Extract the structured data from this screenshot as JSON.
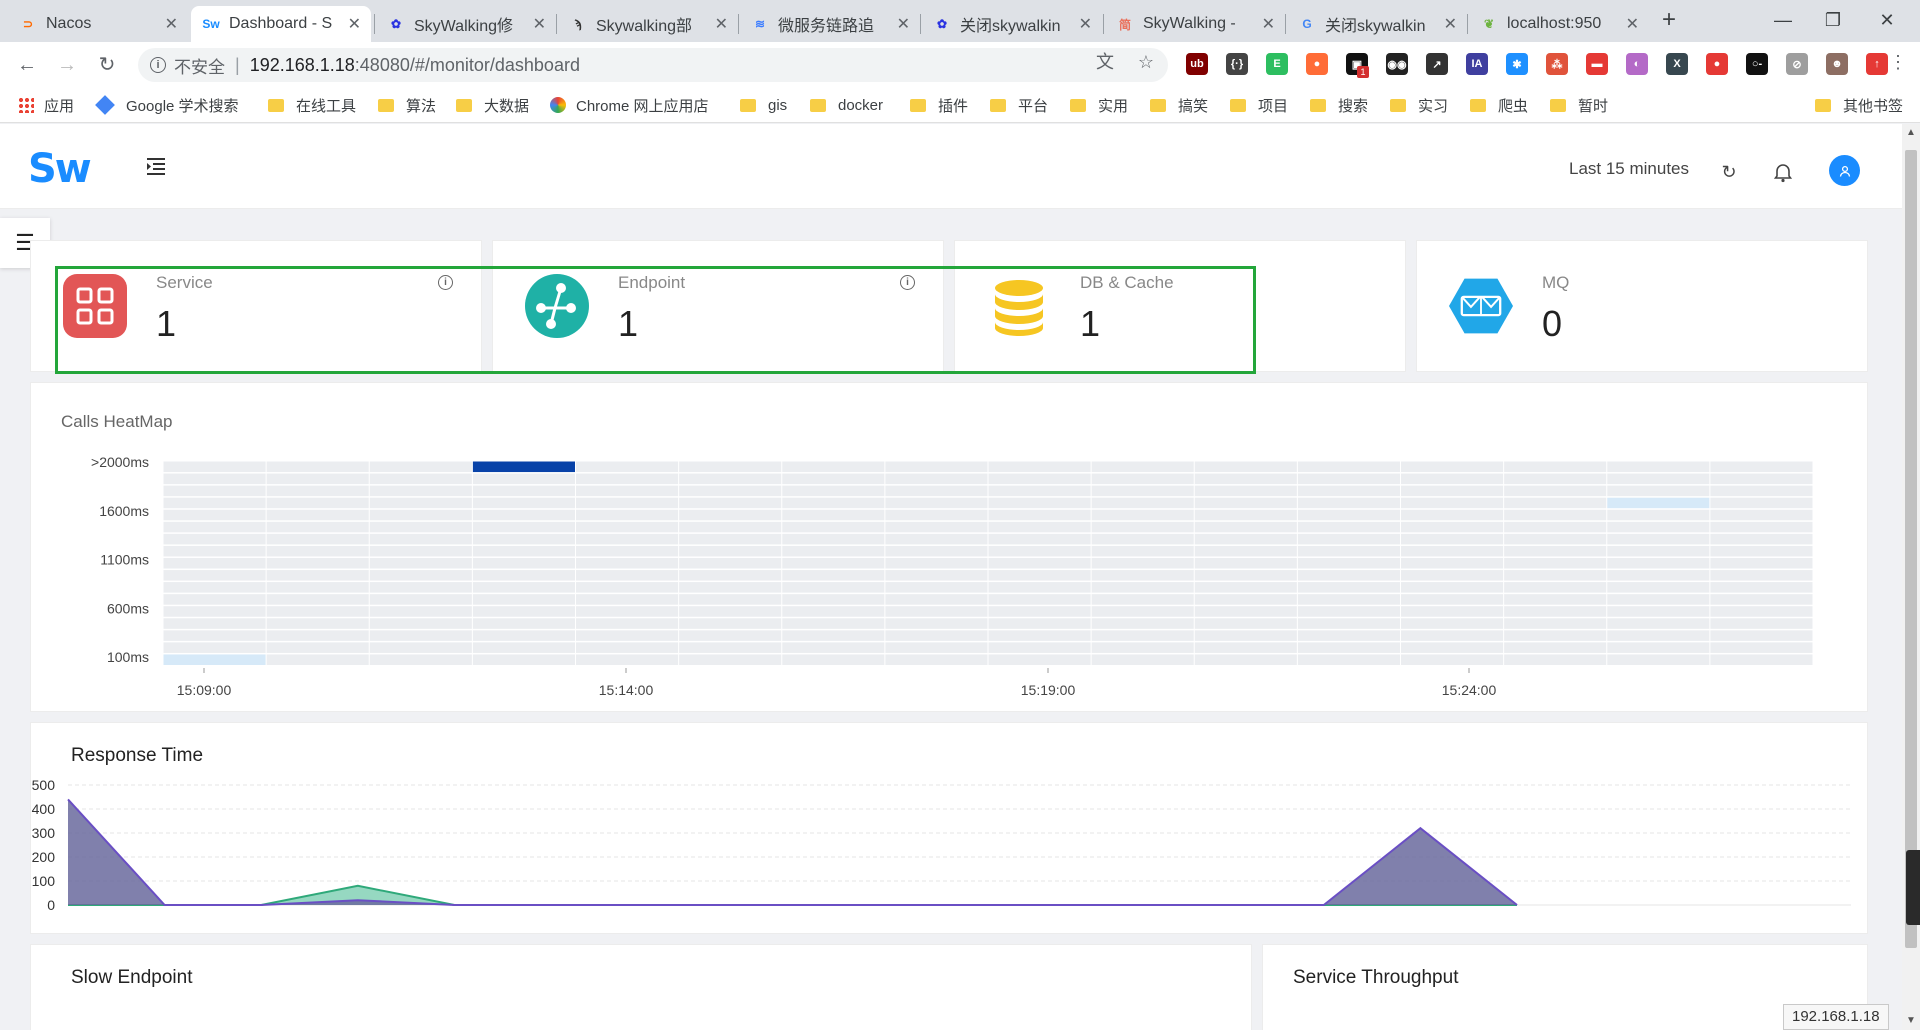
{
  "browser": {
    "tabs": [
      {
        "title": "Nacos",
        "icon": "nacos-icon",
        "color": "#ff6a00",
        "glyph": "⊃"
      },
      {
        "title": "Dashboard - S",
        "icon": "skywalking-icon",
        "color": "#1a8cff",
        "glyph": "Sw"
      },
      {
        "title": "SkyWalking修",
        "icon": "baidu-paw-icon",
        "color": "#2932e1",
        "glyph": "✿"
      },
      {
        "title": "Skywalking部",
        "icon": "yuque-icon",
        "color": "#333333",
        "glyph": "ϡ"
      },
      {
        "title": "微服务链路追",
        "icon": "tencent-cloud-icon",
        "color": "#3b7cff",
        "glyph": "≋"
      },
      {
        "title": "关闭skywalkin",
        "icon": "baidu-paw-icon",
        "color": "#2932e1",
        "glyph": "✿"
      },
      {
        "title": "SkyWalking -",
        "icon": "jianshu-icon",
        "color": "#ea6f5a",
        "glyph": "简"
      },
      {
        "title": "关闭skywalkin",
        "icon": "google-icon",
        "color": "#4285f4",
        "glyph": "G"
      },
      {
        "title": "localhost:950",
        "icon": "spring-leaf-icon",
        "color": "#6db33f",
        "glyph": "❦"
      }
    ],
    "url": {
      "insecure_label": "不安全",
      "host": "192.168.1.18",
      "path": ":48080/#/monitor/dashboard"
    },
    "bookmarks": [
      {
        "label": "应用",
        "kind": "apps"
      },
      {
        "label": "Google 学术搜索",
        "kind": "gem"
      },
      {
        "label": "在线工具",
        "kind": "folder"
      },
      {
        "label": "算法",
        "kind": "folder"
      },
      {
        "label": "大数据",
        "kind": "folder"
      },
      {
        "label": "Chrome 网上应用店",
        "kind": "rainbow"
      },
      {
        "label": "gis",
        "kind": "folder"
      },
      {
        "label": "docker",
        "kind": "folder"
      },
      {
        "label": "插件",
        "kind": "folder"
      },
      {
        "label": "平台",
        "kind": "folder"
      },
      {
        "label": "实用",
        "kind": "folder"
      },
      {
        "label": "搞笑",
        "kind": "folder"
      },
      {
        "label": "项目",
        "kind": "folder"
      },
      {
        "label": "搜索",
        "kind": "folder"
      },
      {
        "label": "实习",
        "kind": "folder"
      },
      {
        "label": "爬虫",
        "kind": "folder"
      },
      {
        "label": "暂时",
        "kind": "folder"
      }
    ],
    "other_bookmarks": "其他书签",
    "extensions": [
      {
        "name": "ublock-icon",
        "color": "#800000",
        "glyph": "ub"
      },
      {
        "name": "json-viewer-icon",
        "color": "#444444",
        "glyph": "{·}"
      },
      {
        "name": "evernote-icon",
        "color": "#2dbe60",
        "glyph": "E"
      },
      {
        "name": "postman-icon",
        "color": "#ff6c37",
        "glyph": "●"
      },
      {
        "name": "extension-badge-icon",
        "color": "#111111",
        "glyph": "▣",
        "badge": "1"
      },
      {
        "name": "mask-icon",
        "color": "#222222",
        "glyph": "◉◉"
      },
      {
        "name": "chart-icon",
        "color": "#333333",
        "glyph": "↗"
      },
      {
        "name": "ia-icon",
        "color": "#3f3f9f",
        "glyph": "IA"
      },
      {
        "name": "star-plugin-icon",
        "color": "#1e90ff",
        "glyph": "✱"
      },
      {
        "name": "molecule-icon",
        "color": "#e0533b",
        "glyph": "⁂"
      },
      {
        "name": "red-square-icon",
        "color": "#e53935",
        "glyph": "▬"
      },
      {
        "name": "pink-circle-icon",
        "color": "#b46ac7",
        "glyph": "◐"
      },
      {
        "name": "x-plugin-icon",
        "color": "#37474f",
        "glyph": "X"
      },
      {
        "name": "location-pin-icon",
        "color": "#e53935",
        "glyph": "●"
      },
      {
        "name": "key-icon",
        "color": "#111111",
        "glyph": "○-"
      },
      {
        "name": "disabled-plugin-icon",
        "color": "#9e9e9e",
        "glyph": "⊘"
      },
      {
        "name": "profile-avatar-icon",
        "color": "#8d6e63",
        "glyph": "☻"
      },
      {
        "name": "update-icon",
        "color": "#e53935",
        "glyph": "↑"
      }
    ],
    "status_bubble": "192.168.1.18"
  },
  "header": {
    "logo": "Sw",
    "time_range": "Last 15 minutes"
  },
  "stats": [
    {
      "label": "Service",
      "value": "1",
      "icon": "service-grid-icon",
      "color": "#e25656"
    },
    {
      "label": "Endpoint",
      "value": "1",
      "icon": "endpoint-nodes-icon",
      "color": "#1fb1a6"
    },
    {
      "label": "DB & Cache",
      "value": "1",
      "icon": "database-icon",
      "color": "#f6c622"
    },
    {
      "label": "MQ",
      "value": "0",
      "icon": "message-queue-icon",
      "color": "#21a7e8"
    }
  ],
  "heatmap": {
    "title": "Calls HeatMap",
    "y_labels": [
      ">2000ms",
      "1600ms",
      "1100ms",
      "600ms",
      "100ms"
    ],
    "x_labels": [
      "15:09:00",
      "15:14:00",
      "15:19:00",
      "15:24:00"
    ],
    "columns": 16,
    "rows": 17,
    "cells": [
      {
        "col": 0,
        "row": 16,
        "shade": "light"
      },
      {
        "col": 3,
        "row": 0,
        "shade": "dark"
      },
      {
        "col": 14,
        "row": 3,
        "shade": "light"
      }
    ],
    "colors": {
      "empty": "#ebedf0",
      "light": "#d6e9f8",
      "dark": "#0842a8"
    }
  },
  "response_time": {
    "title": "Response Time",
    "y_ticks": [
      0,
      100,
      200,
      300,
      400,
      500
    ],
    "chart_data": {
      "type": "area",
      "ylim": [
        0,
        500
      ],
      "x": [
        0,
        1,
        2,
        3,
        4,
        5,
        6,
        7,
        8,
        9,
        10,
        11,
        12,
        13,
        14,
        15
      ],
      "series": [
        {
          "color": "#6a6a9e",
          "values": [
            440,
            0,
            0,
            20,
            0,
            0,
            0,
            0,
            0,
            0,
            0,
            0,
            0,
            0,
            320,
            0
          ]
        },
        {
          "color": "#3fb88e",
          "values": [
            0,
            0,
            0,
            80,
            0,
            0,
            0,
            0,
            0,
            0,
            0,
            0,
            0,
            0,
            0,
            0
          ]
        }
      ]
    }
  },
  "bottom_panels": {
    "slow_endpoint": "Slow Endpoint",
    "service_throughput": "Service Throughput"
  }
}
